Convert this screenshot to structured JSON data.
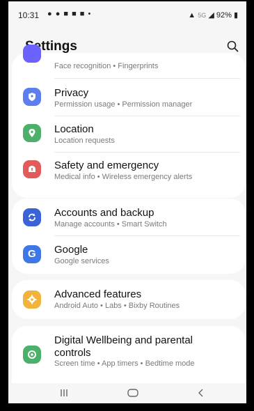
{
  "status_bar": {
    "time": "10:31",
    "notifications": "● ● ■ ■ ■ •",
    "network": "5G",
    "battery": "92%"
  },
  "header": {
    "title": "Settings"
  },
  "groups": [
    {
      "items": [
        {
          "title": "",
          "subtitle": "Face recognition  •  Fingerprints",
          "icon": "biometrics-icon",
          "color": "#6c63ff"
        },
        {
          "title": "Privacy",
          "subtitle": "Permission usage  •  Permission manager",
          "icon": "privacy-shield-icon",
          "color": "#5b7ff0"
        },
        {
          "title": "Location",
          "subtitle": "Location requests",
          "icon": "location-pin-icon",
          "color": "#4cb06a"
        },
        {
          "title": "Safety and emergency",
          "subtitle": "Medical info  •  Wireless emergency alerts",
          "icon": "safety-alert-icon",
          "color": "#e25b5b"
        }
      ]
    },
    {
      "items": [
        {
          "title": "Accounts and backup",
          "subtitle": "Manage accounts  •  Smart Switch",
          "icon": "sync-icon",
          "color": "#3b63d8"
        },
        {
          "title": "Google",
          "subtitle": "Google services",
          "icon": "google-icon",
          "color": "#3f78e6"
        }
      ]
    },
    {
      "items": [
        {
          "title": "Advanced features",
          "subtitle": "Android Auto  •  Labs  •  Bixby Routines",
          "icon": "gear-plus-icon",
          "color": "#f2b33a"
        }
      ]
    },
    {
      "items": [
        {
          "title": "Digital Wellbeing and parental controls",
          "subtitle": "Screen time  •  App timers  •  Bedtime mode",
          "icon": "wellbeing-icon",
          "color": "#4cb06a"
        }
      ]
    }
  ],
  "colors": {
    "background": "#f6f6f6",
    "card": "#ffffff",
    "subtitle": "#7a7a7a"
  }
}
